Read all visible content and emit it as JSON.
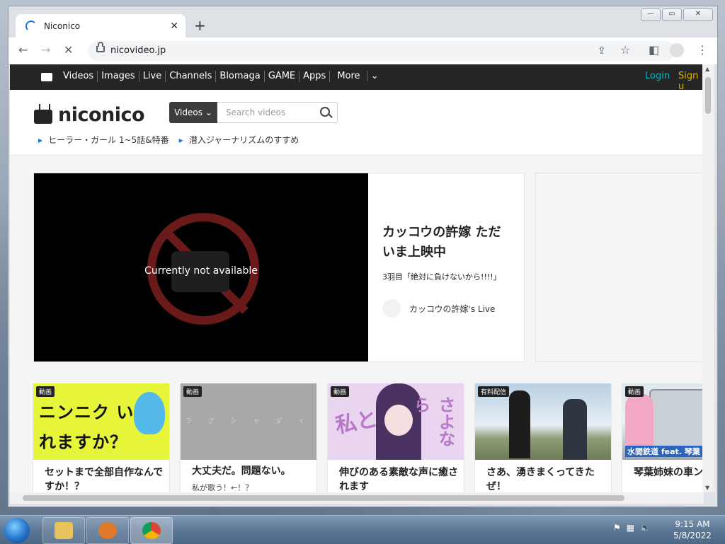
{
  "browser": {
    "tab_title": "Niconico",
    "url": "nicovideo.jp"
  },
  "site": {
    "nav": [
      "Videos",
      "Images",
      "Live",
      "Channels",
      "Blomaga",
      "GAME",
      "Apps",
      "More"
    ],
    "login": "Login",
    "signup": "Sign u",
    "logo_text": "niconico",
    "search_type": "Videos",
    "search_placeholder": "Search videos",
    "trending_tags": [
      "ヒーラー・ガール 1~5話&特番",
      "潜入ジャーナリズムのすすめ"
    ]
  },
  "featured": {
    "player_message": "Currently not available",
    "title": "カッコウの許嫁 ただいま上映中",
    "subtitle": "3羽目「絶対に負けないから!!!!」",
    "channel": "カッコウの許嫁's Live"
  },
  "cards": [
    {
      "badge": "動画",
      "title": "セットまで全部自作なんですか！？",
      "subtitle": "",
      "thumb_text": "ニンニク いれますか？"
    },
    {
      "badge": "動画",
      "title": "大丈夫だ。問題ない。",
      "subtitle": "私が歌う！←！？",
      "thumb_text": "ラ グ シ ャ ダ イ"
    },
    {
      "badge": "動画",
      "title": "伸びのある素敵な声に癒されます",
      "subtitle": "",
      "thumb_text_left": "私と",
      "thumb_text_right": "さよなら"
    },
    {
      "badge": "有料配信",
      "title": "さあ、湧きまくってきたぜ！",
      "subtitle": ""
    },
    {
      "badge": "動画",
      "title": "琴葉姉妹の車ンス！",
      "subtitle": "",
      "thumb_caption": "水間鉄道 feat. 琴葉"
    }
  ],
  "taskbar": {
    "time": "9:15 AM",
    "date": "5/8/2022"
  },
  "colors": {
    "nicobar": "#252525",
    "login": "#00b7c8",
    "signup": "#e0b400",
    "tag_arrow": "#1f7ad6"
  }
}
